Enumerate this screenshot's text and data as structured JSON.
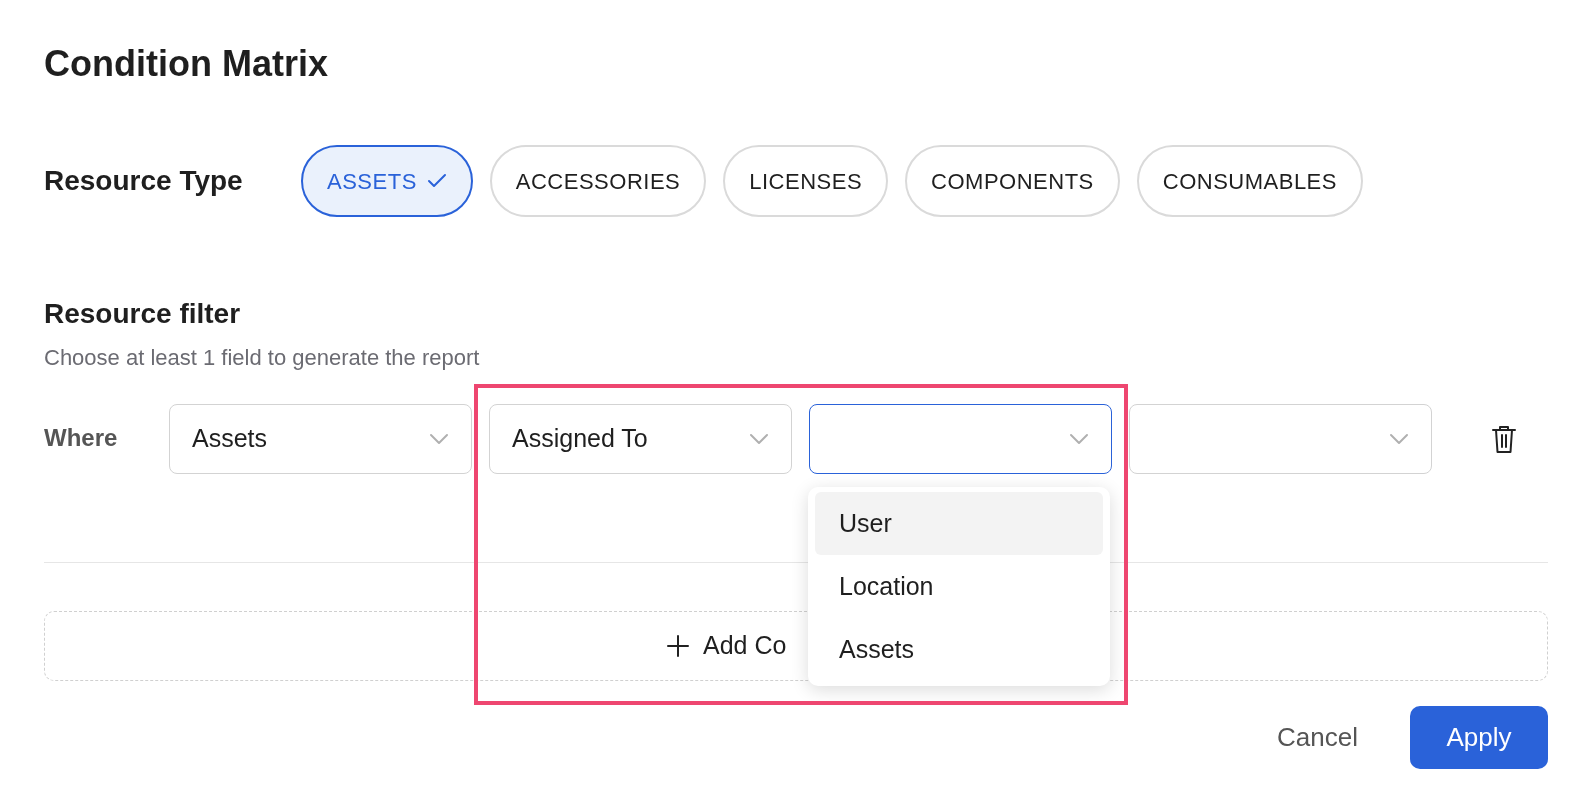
{
  "title": "Condition Matrix",
  "resource_type": {
    "label": "Resource Type",
    "options": [
      {
        "label": "ASSETS",
        "selected": true
      },
      {
        "label": "ACCESSORIES",
        "selected": false
      },
      {
        "label": "LICENSES",
        "selected": false
      },
      {
        "label": "COMPONENTS",
        "selected": false
      },
      {
        "label": "CONSUMABLES",
        "selected": false
      }
    ]
  },
  "resource_filter": {
    "heading": "Resource filter",
    "hint": "Choose at least 1 field to generate the report",
    "row": {
      "label": "Where",
      "selects": [
        {
          "value": "Assets",
          "focused": false
        },
        {
          "value": "Assigned To",
          "focused": false
        },
        {
          "focused": true
        },
        {
          "focused": false
        }
      ]
    },
    "dropdown": {
      "options": [
        {
          "label": "User",
          "selected": true
        },
        {
          "label": "Location",
          "selected": false
        },
        {
          "label": "Assets",
          "selected": false
        }
      ]
    },
    "add_button": "Add Co"
  },
  "footer": {
    "cancel": "Cancel",
    "apply": "Apply"
  }
}
